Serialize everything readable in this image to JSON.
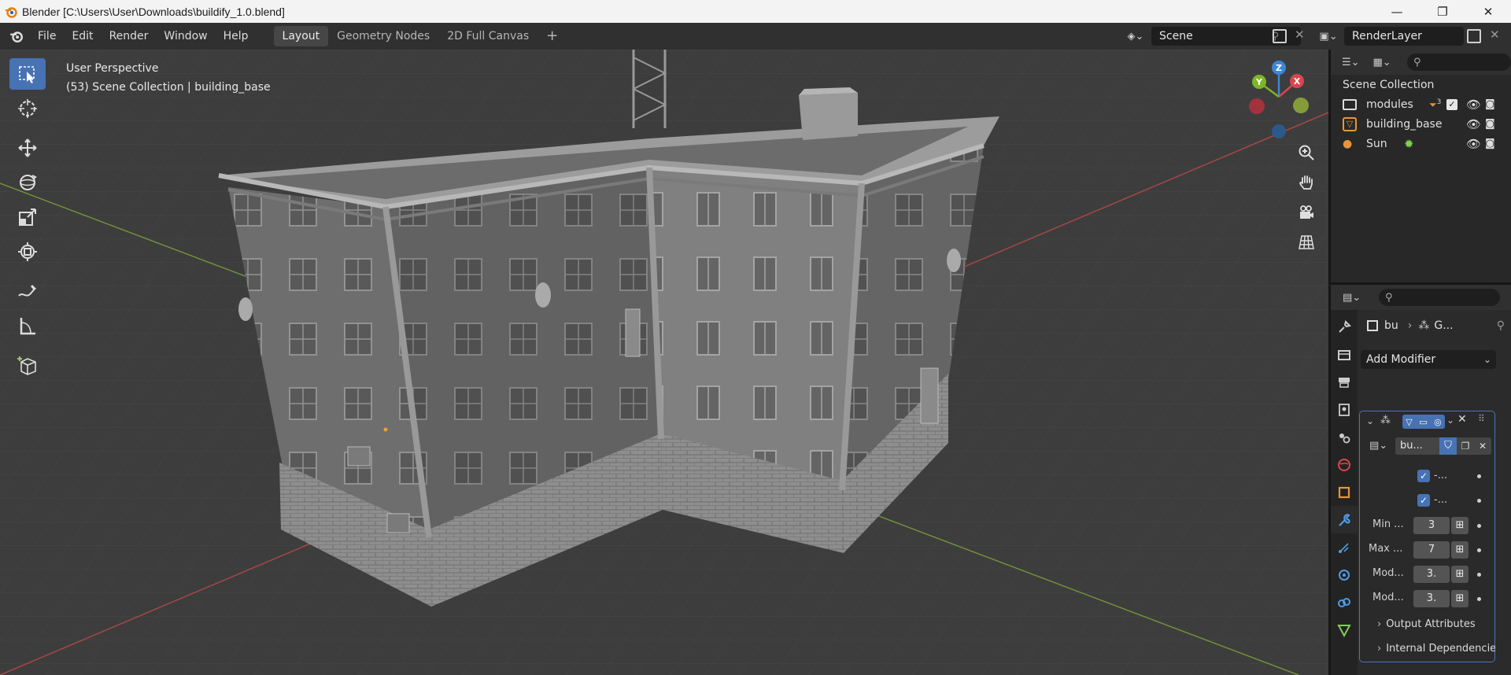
{
  "window": {
    "title": "Blender [C:\\Users\\User\\Downloads\\buildify_1.0.blend]",
    "controls": [
      "—",
      "❐",
      "✕"
    ]
  },
  "menu": [
    "File",
    "Edit",
    "Render",
    "Window",
    "Help"
  ],
  "workspaces": {
    "tabs": [
      "Layout",
      "Geometry Nodes",
      "2D Full Canvas"
    ],
    "active": "Layout",
    "add_label": "+"
  },
  "scene": {
    "name": "Scene"
  },
  "render_layer": {
    "name": "RenderLayer"
  },
  "viewport": {
    "view_name": "User Perspective",
    "context": "(53) Scene Collection | building_base",
    "gizmo": {
      "x": "X",
      "y": "Y",
      "z": "Z"
    },
    "colors": {
      "x_axis": "#c04a4a",
      "y_axis": "#7ea33a",
      "background": "#3d3d3d"
    }
  },
  "outliner": {
    "root": "Scene Collection",
    "items": [
      {
        "name": "modules",
        "icon": "collection-icon",
        "badge": "3"
      },
      {
        "name": "building_base",
        "icon": "mesh-object-icon"
      },
      {
        "name": "Sun",
        "icon": "light-icon"
      }
    ]
  },
  "properties": {
    "breadcrumb": {
      "object": "bu",
      "modifier": "G..."
    },
    "add_modifier": "Add Modifier",
    "modifier": {
      "name": "bu...",
      "toggles": [
        {
          "label": "-...",
          "checked": true
        },
        {
          "label": "-...",
          "checked": true
        }
      ],
      "inputs": [
        {
          "label": "Min ...",
          "value": "3"
        },
        {
          "label": "Max ...",
          "value": "7"
        },
        {
          "label": "Mod...",
          "value": "3."
        },
        {
          "label": "Mod...",
          "value": "3."
        }
      ],
      "subpanels": [
        "Output Attributes",
        "Internal Dependencies"
      ]
    },
    "accent": "#4772b3"
  }
}
